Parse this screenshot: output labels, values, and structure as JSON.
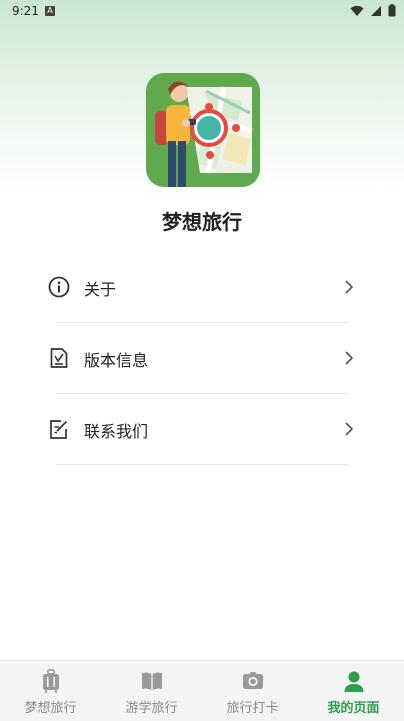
{
  "status_bar": {
    "time": "9:21",
    "notification_glyph": "A",
    "icons": [
      "wifi-icon",
      "signal-icon",
      "battery-icon"
    ]
  },
  "header": {
    "logo": "travel-app-logo",
    "title": "梦想旅行"
  },
  "menu": {
    "items": [
      {
        "label": "关于",
        "icon": "info-icon"
      },
      {
        "label": "版本信息",
        "icon": "document-icon"
      },
      {
        "label": "联系我们",
        "icon": "edit-note-icon"
      }
    ]
  },
  "bottom_nav": {
    "items": [
      {
        "label": "梦想旅行",
        "icon": "luggage-icon",
        "active": false
      },
      {
        "label": "游学旅行",
        "icon": "book-icon",
        "active": false
      },
      {
        "label": "旅行打卡",
        "icon": "camera-icon",
        "active": false
      },
      {
        "label": "我的页面",
        "icon": "user-icon",
        "active": true
      }
    ]
  },
  "colors": {
    "accent_green": "#2e9e4f",
    "logo_green": "#5eaa4d",
    "inactive_gray": "#8a8a8a"
  }
}
